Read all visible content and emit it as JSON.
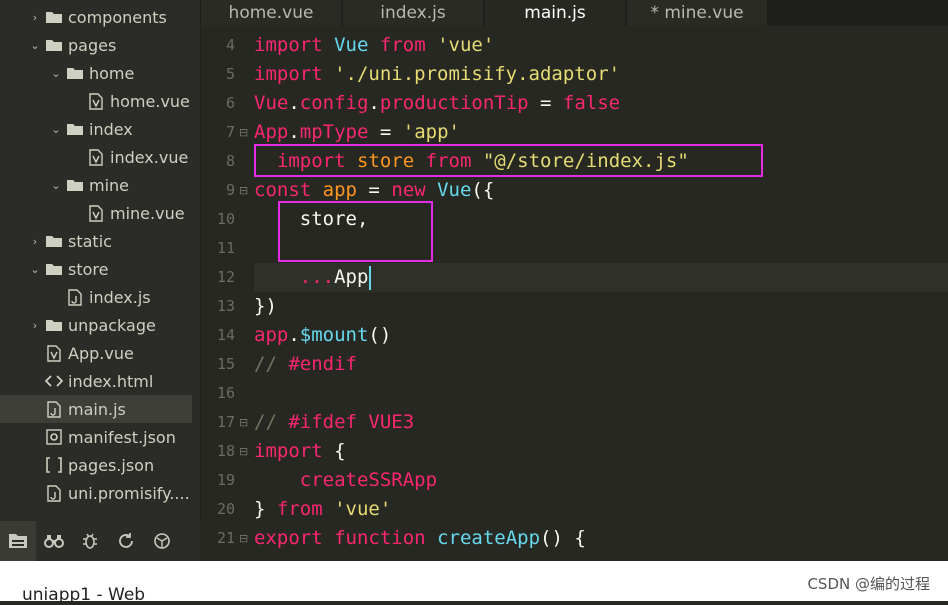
{
  "sidebar": {
    "tree": [
      {
        "label": "components",
        "type": "folder",
        "expanded": false,
        "depth": 0
      },
      {
        "label": "pages",
        "type": "folder",
        "expanded": true,
        "depth": 0
      },
      {
        "label": "home",
        "type": "folder",
        "expanded": true,
        "depth": 1
      },
      {
        "label": "home.vue",
        "type": "vue",
        "depth": 2
      },
      {
        "label": "index",
        "type": "folder",
        "expanded": true,
        "depth": 1
      },
      {
        "label": "index.vue",
        "type": "vue",
        "depth": 2
      },
      {
        "label": "mine",
        "type": "folder",
        "expanded": true,
        "depth": 1
      },
      {
        "label": "mine.vue",
        "type": "vue",
        "depth": 2
      },
      {
        "label": "static",
        "type": "folder",
        "expanded": false,
        "depth": 0
      },
      {
        "label": "store",
        "type": "folder",
        "expanded": true,
        "depth": 0
      },
      {
        "label": "index.js",
        "type": "js",
        "depth": 1
      },
      {
        "label": "unpackage",
        "type": "folder",
        "expanded": false,
        "depth": 0
      },
      {
        "label": "App.vue",
        "type": "vue",
        "depth": 0
      },
      {
        "label": "index.html",
        "type": "html",
        "depth": 0
      },
      {
        "label": "main.js",
        "type": "js",
        "depth": 0,
        "selected": true
      },
      {
        "label": "manifest.json",
        "type": "manifest",
        "depth": 0
      },
      {
        "label": "pages.json",
        "type": "json",
        "depth": 0
      },
      {
        "label": "uni.promisify....",
        "type": "js",
        "depth": 0
      }
    ],
    "tools": [
      "explorer-icon",
      "binoculars-icon",
      "bug-icon",
      "source-control-icon",
      "extensions-icon"
    ]
  },
  "tabs": [
    {
      "label": "home.vue",
      "active": false
    },
    {
      "label": "index.js",
      "active": false
    },
    {
      "label": "main.js",
      "active": true
    },
    {
      "label": "* mine.vue",
      "active": false
    }
  ],
  "editor": {
    "lines": [
      {
        "n": "4",
        "fold": false,
        "tokens": [
          [
            "kw",
            "import"
          ],
          [
            "p",
            " "
          ],
          [
            "cl",
            "Vue"
          ],
          [
            "p",
            " "
          ],
          [
            "kw",
            "from"
          ],
          [
            "p",
            " "
          ],
          [
            "str",
            "'vue'"
          ]
        ]
      },
      {
        "n": "5",
        "fold": false,
        "tokens": [
          [
            "kw",
            "import"
          ],
          [
            "p",
            " "
          ],
          [
            "str",
            "'./uni.promisify.adaptor'"
          ]
        ]
      },
      {
        "n": "6",
        "fold": false,
        "tokens": [
          [
            "kw",
            "Vue"
          ],
          [
            "p",
            "."
          ],
          [
            "kw",
            "config"
          ],
          [
            "p",
            "."
          ],
          [
            "kw",
            "productionTip"
          ],
          [
            "p",
            " = "
          ],
          [
            "kw",
            "false"
          ]
        ]
      },
      {
        "n": "7",
        "fold": true,
        "tokens": [
          [
            "kw",
            "App"
          ],
          [
            "p",
            "."
          ],
          [
            "kw",
            "mpType"
          ],
          [
            "p",
            " = "
          ],
          [
            "str",
            "'app'"
          ]
        ]
      },
      {
        "n": "8",
        "fold": false,
        "tokens": [
          [
            "p",
            "  "
          ],
          [
            "kw",
            "import"
          ],
          [
            "p",
            " "
          ],
          [
            "var",
            "store"
          ],
          [
            "p",
            " "
          ],
          [
            "kw",
            "from"
          ],
          [
            "p",
            " "
          ],
          [
            "str",
            "\"@/store/index.js\""
          ]
        ]
      },
      {
        "n": "9",
        "fold": true,
        "tokens": [
          [
            "kw",
            "const"
          ],
          [
            "p",
            " "
          ],
          [
            "var",
            "app"
          ],
          [
            "p",
            " = "
          ],
          [
            "kw",
            "new"
          ],
          [
            "p",
            " "
          ],
          [
            "cl",
            "Vue"
          ],
          [
            "p",
            "({"
          ]
        ]
      },
      {
        "n": "10",
        "fold": false,
        "tokens": [
          [
            "p",
            "    store,"
          ]
        ]
      },
      {
        "n": "11",
        "fold": false,
        "tokens": []
      },
      {
        "n": "12",
        "fold": false,
        "current": true,
        "caret": true,
        "tokens": [
          [
            "p",
            "    "
          ],
          [
            "kw",
            "..."
          ],
          [
            "p",
            "App"
          ]
        ]
      },
      {
        "n": "13",
        "fold": false,
        "tokens": [
          [
            "p",
            "})"
          ]
        ]
      },
      {
        "n": "14",
        "fold": false,
        "tokens": [
          [
            "kw",
            "app"
          ],
          [
            "p",
            "."
          ],
          [
            "fn",
            "$mount"
          ],
          [
            "p",
            "()"
          ]
        ]
      },
      {
        "n": "15",
        "fold": false,
        "tokens": [
          [
            "cm",
            "// "
          ],
          [
            "pp",
            "#endif"
          ]
        ]
      },
      {
        "n": "16",
        "fold": false,
        "tokens": []
      },
      {
        "n": "17",
        "fold": true,
        "tokens": [
          [
            "cm",
            "// "
          ],
          [
            "pp",
            "#ifdef"
          ],
          [
            "p",
            " "
          ],
          [
            "pp",
            "VUE3"
          ]
        ]
      },
      {
        "n": "18",
        "fold": true,
        "tokens": [
          [
            "kw",
            "import"
          ],
          [
            "p",
            " {"
          ]
        ]
      },
      {
        "n": "19",
        "fold": false,
        "tokens": [
          [
            "p",
            "    "
          ],
          [
            "kw",
            "createSSRApp"
          ]
        ]
      },
      {
        "n": "20",
        "fold": false,
        "tokens": [
          [
            "p",
            "} "
          ],
          [
            "kw",
            "from"
          ],
          [
            "p",
            " "
          ],
          [
            "str",
            "'vue'"
          ]
        ]
      },
      {
        "n": "21",
        "fold": true,
        "tokens": [
          [
            "kw",
            "export"
          ],
          [
            "p",
            " "
          ],
          [
            "kw",
            "function"
          ],
          [
            "p",
            " "
          ],
          [
            "fn",
            "createApp"
          ],
          [
            "p",
            "() {"
          ]
        ]
      }
    ]
  },
  "status": {
    "project": "uniapp1 - Web",
    "watermark": "CSDN @编的过程"
  },
  "colors": {
    "highlight_box": "#e52ce5",
    "keyword": "#f92672",
    "string": "#e6db74",
    "builtin": "#66d9ef",
    "variable": "#fd971f"
  }
}
